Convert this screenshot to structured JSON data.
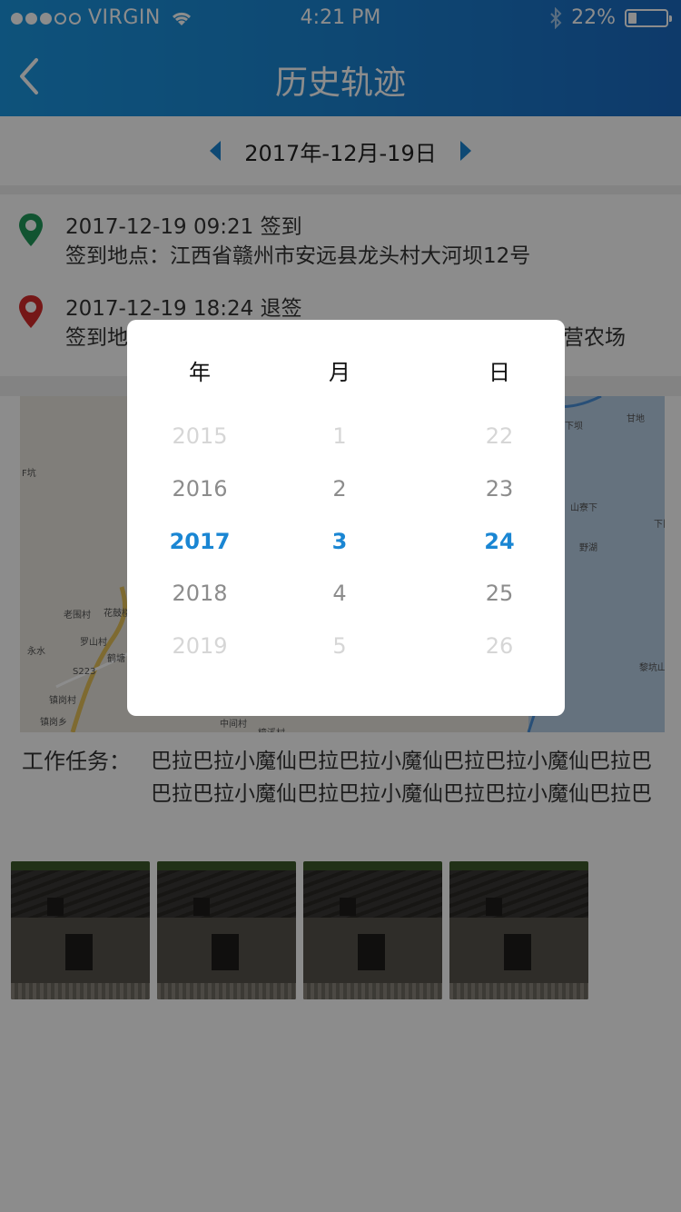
{
  "status_bar": {
    "carrier": "VIRGIN",
    "time": "4:21 PM",
    "battery": "22%",
    "battery_level": 0.22,
    "signal_bars_filled": 3,
    "signal_bars_total": 5
  },
  "header": {
    "title": "历史轨迹",
    "back_icon": "chevron-left-icon"
  },
  "date_nav": {
    "date": "2017年-12月-19日",
    "prev_icon": "triangle-left-icon",
    "next_icon": "triangle-right-icon"
  },
  "sign_in": {
    "time": "2017-12-19  09:21 签到",
    "address": "签到地点：江西省赣州市安远县龙头村大河坝12号",
    "pin_color": "#1f9a5a"
  },
  "sign_out": {
    "time": "2017-12-19  18:24 退签",
    "address_visible_left": "签到地",
    "address_visible_right": "营农场",
    "pin_color": "#d62a2a"
  },
  "map": {
    "labels": [
      "F坑",
      "老围村",
      "花鼓楼",
      "罗山村",
      "永水",
      "鹤塘",
      "S223",
      "镇岗村",
      "镇岗乡",
      "中间村",
      "樟溪村",
      "甘地",
      "下坝",
      "山寮下",
      "野湖",
      "下旧",
      "黎坑山"
    ]
  },
  "task": {
    "label": "工作任务：",
    "text": "巴拉巴拉小魔仙巴拉巴拉小魔仙巴拉巴拉小魔仙巴拉巴巴拉巴拉小魔仙巴拉巴拉小魔仙巴拉巴拉小魔仙巴拉巴"
  },
  "photos": [
    "photo-1",
    "photo-2",
    "photo-3",
    "photo-4"
  ],
  "picker": {
    "headers": {
      "year": "年",
      "month": "月",
      "day": "日"
    },
    "year": [
      "2015",
      "2016",
      "2017",
      "2018",
      "2019"
    ],
    "month": [
      "1",
      "2",
      "3",
      "4",
      "5"
    ],
    "day": [
      "22",
      "23",
      "24",
      "25",
      "26"
    ],
    "selected_index": 2,
    "accent_color": "#1a86d3"
  }
}
